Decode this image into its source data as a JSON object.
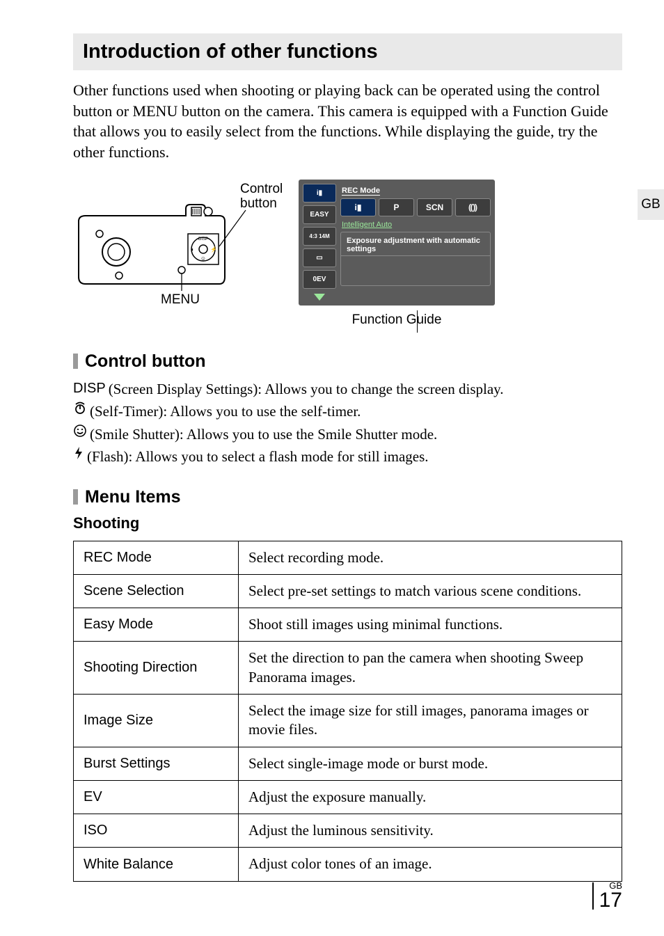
{
  "header": {
    "title": "Introduction of other functions"
  },
  "intro": "Other functions used when shooting or playing back can be operated using the control button or MENU button on the camera. This camera is equipped with a Function Guide that allows you to easily select from the functions. While displaying the guide, try the other functions.",
  "fig_left": {
    "control_button_label": "Control button",
    "menu_label": "MENU",
    "disp_marker": "DISP"
  },
  "fig_right": {
    "rec_mode_label": "REC Mode",
    "tabs": [
      "i▮",
      "P",
      "SCN",
      "⸨⸩"
    ],
    "left_tiles": [
      "i▮",
      "EASY",
      "4:3 14M",
      "▭",
      "0EV",
      "▼"
    ],
    "intelligent_auto": "Intelligent Auto",
    "guide_text": "Exposure adjustment with automatic settings",
    "caption": "Function Guide"
  },
  "side_tab": "GB",
  "section_cb": {
    "heading": "Control button",
    "items": [
      {
        "lead_type": "text",
        "lead": "DISP",
        "body": " (Screen Display Settings): Allows you to change the screen display."
      },
      {
        "lead_type": "timer",
        "body": " (Self-Timer): Allows you to use the self-timer."
      },
      {
        "lead_type": "smile",
        "body": " (Smile Shutter): Allows you to use the Smile Shutter mode."
      },
      {
        "lead_type": "flash",
        "body": " (Flash): Allows you to select a flash mode for still images."
      }
    ]
  },
  "section_menu": {
    "heading": "Menu Items",
    "category": "Shooting",
    "rows": [
      {
        "name": "REC Mode",
        "desc": "Select recording mode."
      },
      {
        "name": "Scene Selection",
        "desc": "Select pre-set settings to match various scene conditions."
      },
      {
        "name": "Easy Mode",
        "desc": "Shoot still images using minimal functions."
      },
      {
        "name": "Shooting Direction",
        "desc": "Set the direction to pan the camera when shooting Sweep Panorama images."
      },
      {
        "name": "Image Size",
        "desc": "Select the image size for still images, panorama images or movie files."
      },
      {
        "name": "Burst Settings",
        "desc": "Select single-image mode or burst mode."
      },
      {
        "name": "EV",
        "desc": "Adjust the exposure manually."
      },
      {
        "name": "ISO",
        "desc": "Adjust the luminous sensitivity."
      },
      {
        "name": "White Balance",
        "desc": "Adjust color tones of an image."
      }
    ]
  },
  "footer": {
    "lang": "GB",
    "page": "17"
  }
}
